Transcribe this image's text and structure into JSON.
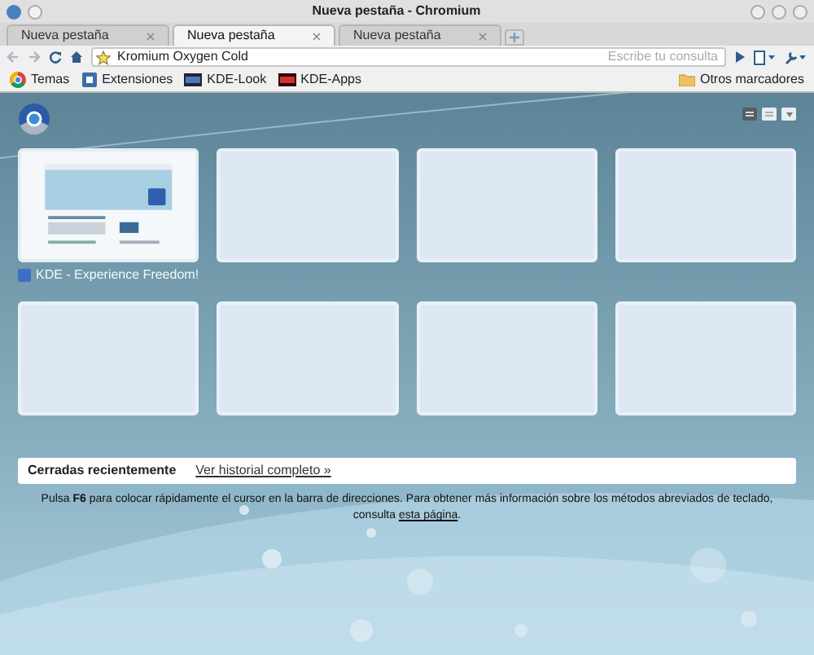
{
  "window": {
    "title": "Nueva pestaña - Chromium"
  },
  "tabs": [
    {
      "label": "Nueva pestaña",
      "selected": false
    },
    {
      "label": "Nueva pestaña",
      "selected": true
    },
    {
      "label": "Nueva pestaña",
      "selected": false
    }
  ],
  "address_bar": {
    "value": "Kromium Oxygen Cold",
    "placeholder": "Escribe tu consulta"
  },
  "bookmarks": [
    {
      "label": "Temas",
      "kind": "chrome"
    },
    {
      "label": "Extensiones",
      "kind": "puzzle"
    },
    {
      "label": "KDE-Look",
      "kind": "kde"
    },
    {
      "label": "KDE-Apps",
      "kind": "kdeapps"
    }
  ],
  "other_bookmarks": "Otros marcadores",
  "view_modes": [
    {
      "selected": true
    },
    {
      "selected": false
    }
  ],
  "thumbnails": [
    {
      "kind": "picture",
      "title": "KDE - Experience Freedom!"
    },
    {
      "kind": "empty"
    },
    {
      "kind": "empty"
    },
    {
      "kind": "empty"
    },
    {
      "kind": "empty"
    },
    {
      "kind": "empty"
    },
    {
      "kind": "empty"
    },
    {
      "kind": "empty"
    }
  ],
  "recently_closed": {
    "title": "Cerradas recientemente",
    "link": "Ver historial completo »"
  },
  "help": {
    "text": "Pulsa **F6** para colocar rápidamente el cursor en la barra de direcciones. Para obtener más información sobre los métodos abreviados de teclado, consulta",
    "link": "esta página",
    "after": "."
  }
}
